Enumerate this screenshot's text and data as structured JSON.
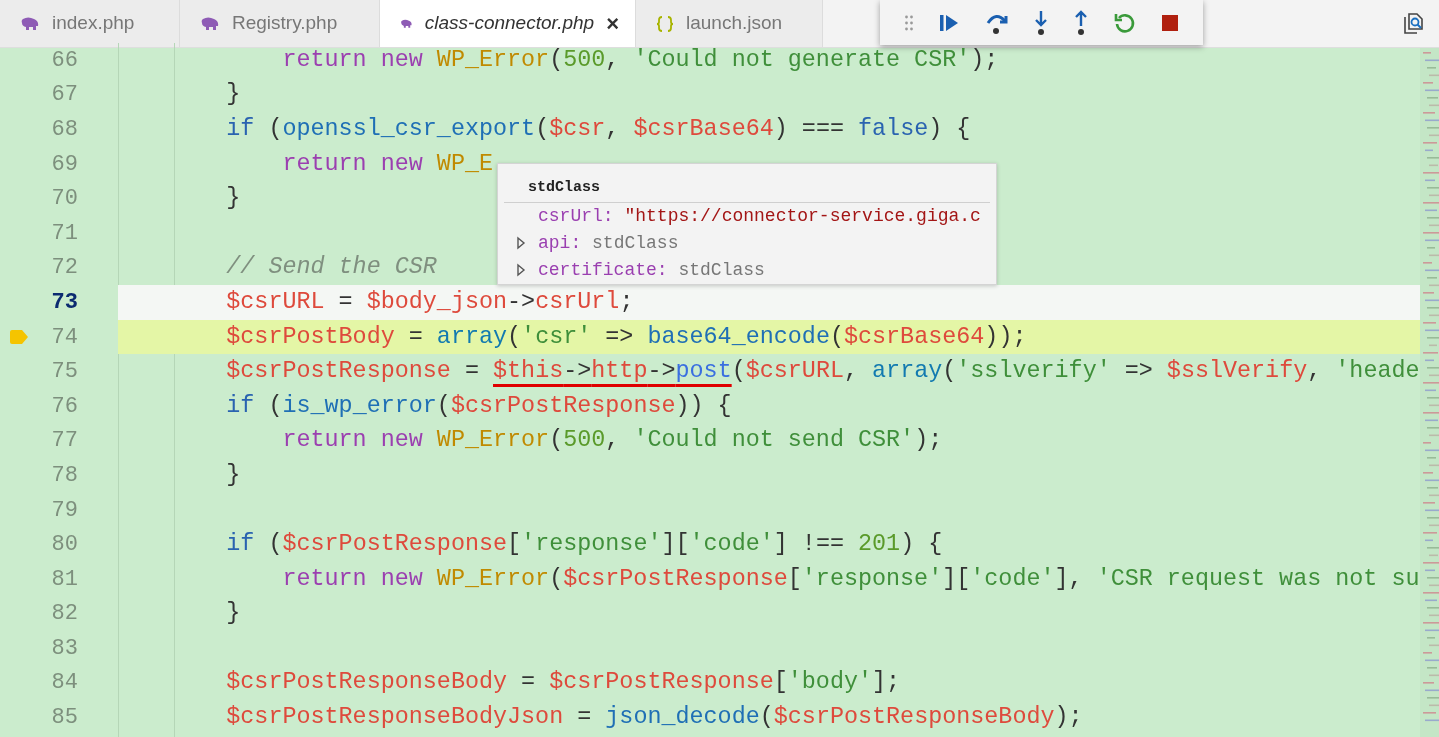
{
  "tabs": [
    {
      "label": "index.php",
      "kind": "php",
      "selected": false
    },
    {
      "label": "Registry.php",
      "kind": "php",
      "selected": false
    },
    {
      "label": "class-connector.php",
      "kind": "php",
      "selected": true
    },
    {
      "label": "launch.json",
      "kind": "json",
      "selected": false
    }
  ],
  "close_glyph": "×",
  "editor": {
    "lines": [
      {
        "number": "66",
        "active": false,
        "paused": false,
        "tokens": [
          {
            "kind": "keyword",
            "text": "            return new "
          },
          {
            "kind": "class",
            "text": "WP_Error"
          },
          {
            "kind": "plain",
            "text": "("
          },
          {
            "kind": "number",
            "text": "500"
          },
          {
            "kind": "plain",
            "text": ", "
          },
          {
            "kind": "string",
            "text": "'Could not generate CSR'"
          },
          {
            "kind": "plain",
            "text": ");"
          }
        ]
      },
      {
        "number": "67",
        "active": false,
        "paused": false,
        "tokens": [
          {
            "kind": "plain",
            "text": "        }"
          }
        ]
      },
      {
        "number": "68",
        "active": false,
        "paused": false,
        "tokens": [
          {
            "kind": "control",
            "text": "        if"
          },
          {
            "kind": "plain",
            "text": " ("
          },
          {
            "kind": "function",
            "text": "openssl_csr_export"
          },
          {
            "kind": "plain",
            "text": "("
          },
          {
            "kind": "variable",
            "text": "$csr"
          },
          {
            "kind": "plain",
            "text": ", "
          },
          {
            "kind": "variable",
            "text": "$csrBase64"
          },
          {
            "kind": "plain",
            "text": ") === "
          },
          {
            "kind": "constant",
            "text": "false"
          },
          {
            "kind": "plain",
            "text": ") {"
          }
        ]
      },
      {
        "number": "69",
        "active": false,
        "paused": false,
        "tokens": [
          {
            "kind": "keyword",
            "text": "            return new "
          },
          {
            "kind": "class",
            "text": "WP_E"
          }
        ]
      },
      {
        "number": "70",
        "active": false,
        "paused": false,
        "tokens": [
          {
            "kind": "plain",
            "text": "        }"
          }
        ]
      },
      {
        "number": "71",
        "active": false,
        "paused": false
      },
      {
        "number": "72",
        "active": false,
        "paused": false,
        "tokens": [
          {
            "kind": "comment",
            "text": "        // Send the CSR"
          }
        ]
      },
      {
        "number": "73",
        "active": true,
        "paused": false,
        "tokens": [
          {
            "kind": "variable",
            "text": "        $csrURL"
          },
          {
            "kind": "plain",
            "text": " = "
          },
          {
            "kind": "variable",
            "text": "$body_json"
          },
          {
            "kind": "plain",
            "text": "->"
          },
          {
            "kind": "variable",
            "text": "csrUrl"
          },
          {
            "kind": "plain",
            "text": ";"
          }
        ]
      },
      {
        "number": "74",
        "active": false,
        "paused": true,
        "tokens": [
          {
            "kind": "variable",
            "text": "        $csrPostBody"
          },
          {
            "kind": "plain",
            "text": " = "
          },
          {
            "kind": "builtin",
            "text": "array"
          },
          {
            "kind": "plain",
            "text": "("
          },
          {
            "kind": "string",
            "text": "'csr'"
          },
          {
            "kind": "plain",
            "text": " => "
          },
          {
            "kind": "function",
            "text": "base64_encode"
          },
          {
            "kind": "plain",
            "text": "("
          },
          {
            "kind": "variable",
            "text": "$csrBase64"
          },
          {
            "kind": "plain",
            "text": "));"
          }
        ]
      },
      {
        "number": "75",
        "active": false,
        "paused": false,
        "tokens": [
          {
            "kind": "variable",
            "text": "        $csrPostResponse"
          },
          {
            "kind": "plain",
            "text": " = "
          },
          {
            "kind": "underlined",
            "tokens": [
              {
                "kind": "variable",
                "text": "$this"
              },
              {
                "kind": "plain",
                "text": "->"
              },
              {
                "kind": "variable",
                "text": "http"
              },
              {
                "kind": "plain",
                "text": "->"
              },
              {
                "kind": "method",
                "text": "post"
              }
            ]
          },
          {
            "kind": "plain",
            "text": "("
          },
          {
            "kind": "variable",
            "text": "$csrURL"
          },
          {
            "kind": "plain",
            "text": ", "
          },
          {
            "kind": "builtin",
            "text": "array"
          },
          {
            "kind": "plain",
            "text": "("
          },
          {
            "kind": "string",
            "text": "'sslverify'"
          },
          {
            "kind": "plain",
            "text": " => "
          },
          {
            "kind": "variable",
            "text": "$sslVerify"
          },
          {
            "kind": "plain",
            "text": ", "
          },
          {
            "kind": "string",
            "text": "'heade"
          }
        ]
      },
      {
        "number": "76",
        "active": false,
        "paused": false,
        "tokens": [
          {
            "kind": "control",
            "text": "        if"
          },
          {
            "kind": "plain",
            "text": " ("
          },
          {
            "kind": "function",
            "text": "is_wp_error"
          },
          {
            "kind": "plain",
            "text": "("
          },
          {
            "kind": "variable",
            "text": "$csrPostResponse"
          },
          {
            "kind": "plain",
            "text": ")) {"
          }
        ]
      },
      {
        "number": "77",
        "active": false,
        "paused": false,
        "tokens": [
          {
            "kind": "keyword",
            "text": "            return new "
          },
          {
            "kind": "class",
            "text": "WP_Error"
          },
          {
            "kind": "plain",
            "text": "("
          },
          {
            "kind": "number",
            "text": "500"
          },
          {
            "kind": "plain",
            "text": ", "
          },
          {
            "kind": "string",
            "text": "'Could not send CSR'"
          },
          {
            "kind": "plain",
            "text": ");"
          }
        ]
      },
      {
        "number": "78",
        "active": false,
        "paused": false,
        "tokens": [
          {
            "kind": "plain",
            "text": "        }"
          }
        ]
      },
      {
        "number": "79",
        "active": false,
        "paused": false
      },
      {
        "number": "80",
        "active": false,
        "paused": false,
        "tokens": [
          {
            "kind": "control",
            "text": "        if"
          },
          {
            "kind": "plain",
            "text": " ("
          },
          {
            "kind": "variable",
            "text": "$csrPostResponse"
          },
          {
            "kind": "plain",
            "text": "["
          },
          {
            "kind": "string",
            "text": "'response'"
          },
          {
            "kind": "plain",
            "text": "]["
          },
          {
            "kind": "string",
            "text": "'code'"
          },
          {
            "kind": "plain",
            "text": "] !== "
          },
          {
            "kind": "number",
            "text": "201"
          },
          {
            "kind": "plain",
            "text": ") {"
          }
        ]
      },
      {
        "number": "81",
        "active": false,
        "paused": false,
        "tokens": [
          {
            "kind": "keyword",
            "text": "            return new "
          },
          {
            "kind": "class",
            "text": "WP_Error"
          },
          {
            "kind": "plain",
            "text": "("
          },
          {
            "kind": "variable",
            "text": "$csrPostResponse"
          },
          {
            "kind": "plain",
            "text": "["
          },
          {
            "kind": "string",
            "text": "'response'"
          },
          {
            "kind": "plain",
            "text": "]["
          },
          {
            "kind": "string",
            "text": "'code'"
          },
          {
            "kind": "plain",
            "text": "], "
          },
          {
            "kind": "string",
            "text": "'CSR request was not su"
          }
        ]
      },
      {
        "number": "82",
        "active": false,
        "paused": false,
        "tokens": [
          {
            "kind": "plain",
            "text": "        }"
          }
        ]
      },
      {
        "number": "83",
        "active": false,
        "paused": false
      },
      {
        "number": "84",
        "active": false,
        "paused": false,
        "tokens": [
          {
            "kind": "variable",
            "text": "        $csrPostResponseBody"
          },
          {
            "kind": "plain",
            "text": " = "
          },
          {
            "kind": "variable",
            "text": "$csrPostResponse"
          },
          {
            "kind": "plain",
            "text": "["
          },
          {
            "kind": "string",
            "text": "'body'"
          },
          {
            "kind": "plain",
            "text": "];"
          }
        ]
      },
      {
        "number": "85",
        "active": false,
        "paused": false,
        "tokens": [
          {
            "kind": "variable",
            "text": "        $csrPostResponseBodyJson"
          },
          {
            "kind": "plain",
            "text": " = "
          },
          {
            "kind": "function",
            "text": "json_decode"
          },
          {
            "kind": "plain",
            "text": "("
          },
          {
            "kind": "variable",
            "text": "$csrPostResponseBody"
          },
          {
            "kind": "plain",
            "text": ");"
          }
        ]
      }
    ]
  },
  "hover": {
    "title": "stdClass",
    "rows": [
      {
        "name": "csrUrl:",
        "value": "\"https://connector-service.giga.c",
        "kind": "string"
      },
      {
        "name": "api:",
        "value": "stdClass",
        "kind": "object",
        "expanded": false
      },
      {
        "name": "certificate:",
        "value": "stdClass",
        "kind": "object",
        "expanded": false
      }
    ]
  }
}
